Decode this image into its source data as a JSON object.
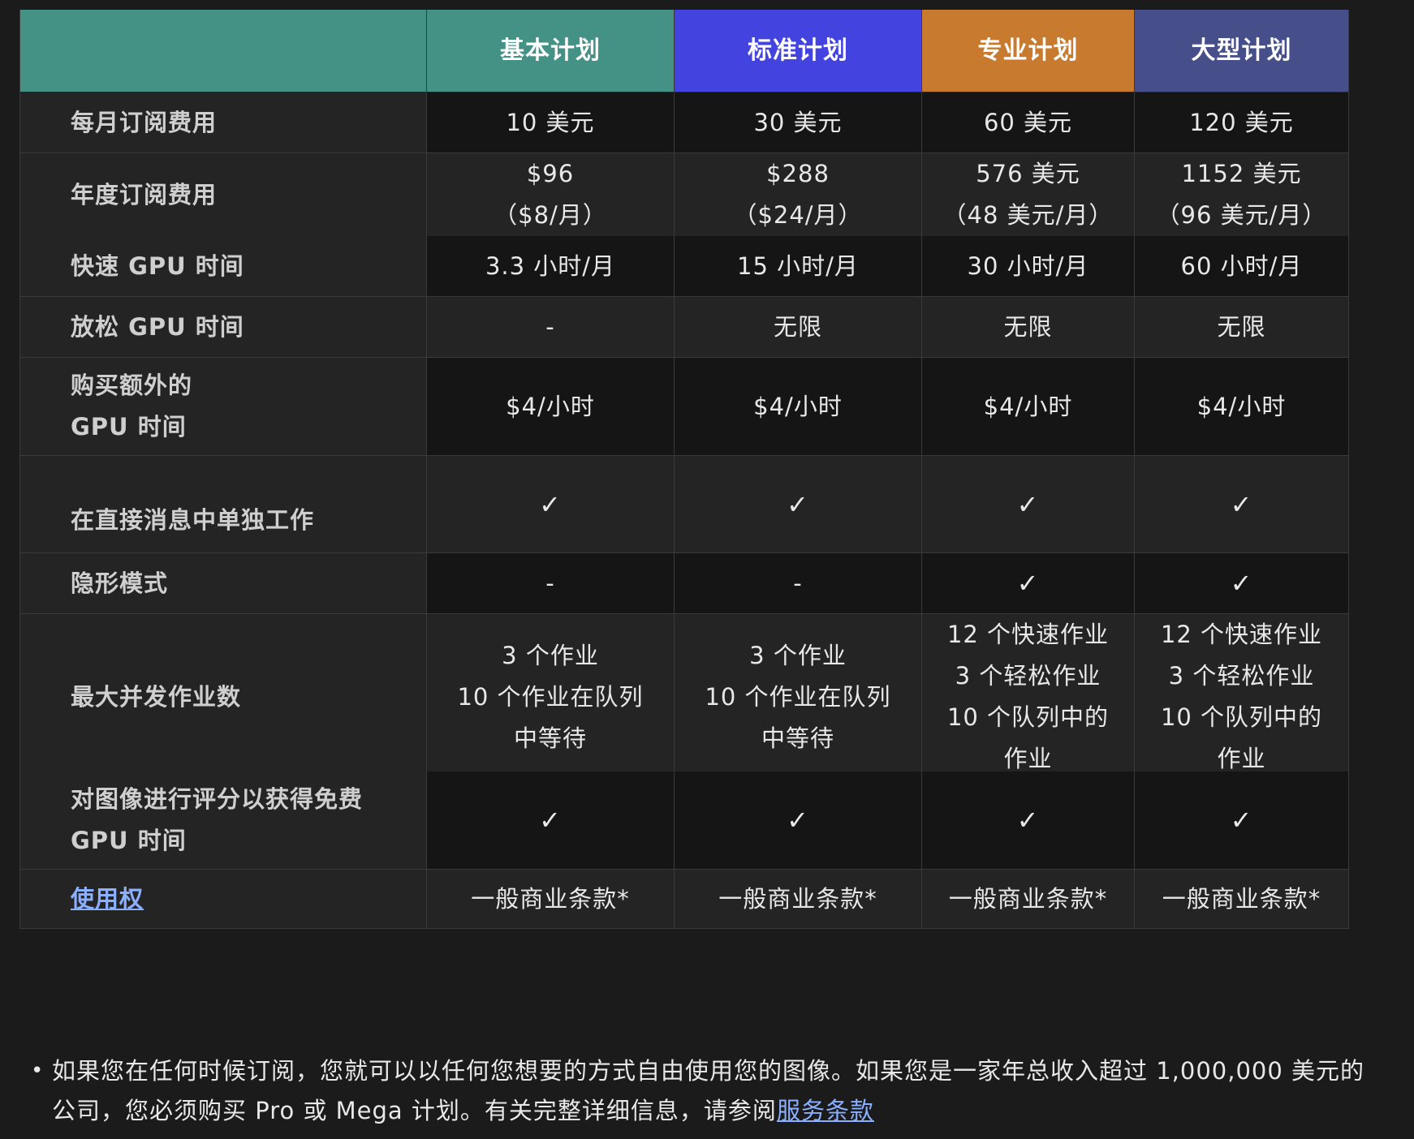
{
  "plans": [
    "基本计划",
    "标准计划",
    "专业计划",
    "大型计划"
  ],
  "plan_colors": [
    "#449185",
    "#4343e0",
    "#c87a2e",
    "#474f8a"
  ],
  "rows": [
    {
      "label": "每月订阅费用",
      "cells": [
        "10 美元",
        "30 美元",
        "60 美元",
        "120 美元"
      ]
    },
    {
      "label": "年度订阅费用",
      "cells": [
        "$96\n（$8/月）",
        "$288\n（$24/月）",
        "576 美元\n（48 美元/月）",
        "1152 美元\n（96 美元/月）"
      ]
    },
    {
      "label": "快速 GPU 时间",
      "cells": [
        "3.3 小时/月",
        "15 小时/月",
        "30 小时/月",
        "60 小时/月"
      ]
    },
    {
      "label": "放松 GPU 时间",
      "cells": [
        "-",
        "无限",
        "无限",
        "无限"
      ]
    },
    {
      "label": "购买额外的\nGPU 时间",
      "cells": [
        "$4/小时",
        "$4/小时",
        "$4/小时",
        "$4/小时"
      ]
    },
    {
      "label": "在直接消息中单独工作",
      "cells": [
        "✓",
        "✓",
        "✓",
        "✓"
      ]
    },
    {
      "label": "隐形模式",
      "cells": [
        "-",
        "-",
        "✓",
        "✓"
      ]
    },
    {
      "label": "最大并发作业数",
      "cells": [
        "3 个作业\n10 个作业在队列\n中等待",
        "3 个作业\n10 个作业在队列\n中等待",
        "12 个快速作业\n3 个轻松作业\n10 个队列中的\n作业",
        "12 个快速作业\n3 个轻松作业\n10 个队列中的\n作业"
      ]
    },
    {
      "label": "对图像进行评分以获得免费\nGPU 时间",
      "cells": [
        "✓",
        "✓",
        "✓",
        "✓"
      ]
    },
    {
      "label": "使用权",
      "cells": [
        "一般商业条款*",
        "一般商业条款*",
        "一般商业条款*",
        "一般商业条款*"
      ]
    }
  ],
  "footnote": {
    "bullet": "•",
    "text": "如果您在任何时候订阅，您就可以以任何您想要的方式自由使用您的图像。如果您是一家年总收入超过 1,000,000 美元的公司，您必须购买 Pro 或 Mega 计划。有关完整详细信息，请参阅",
    "link": "服务条款"
  }
}
